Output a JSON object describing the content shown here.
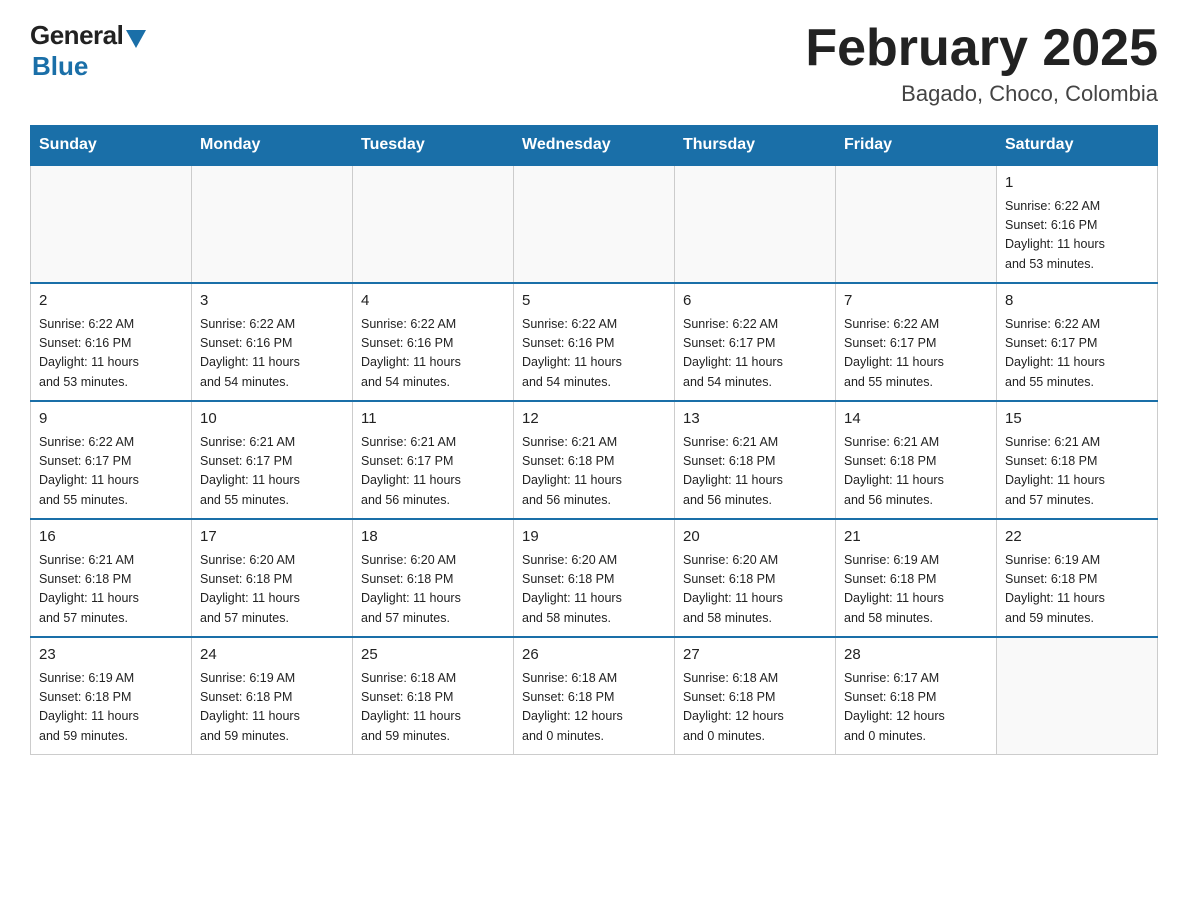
{
  "header": {
    "logo_general": "General",
    "logo_blue": "Blue",
    "title": "February 2025",
    "location": "Bagado, Choco, Colombia"
  },
  "days_of_week": [
    "Sunday",
    "Monday",
    "Tuesday",
    "Wednesday",
    "Thursday",
    "Friday",
    "Saturday"
  ],
  "weeks": [
    [
      {
        "day": "",
        "info": ""
      },
      {
        "day": "",
        "info": ""
      },
      {
        "day": "",
        "info": ""
      },
      {
        "day": "",
        "info": ""
      },
      {
        "day": "",
        "info": ""
      },
      {
        "day": "",
        "info": ""
      },
      {
        "day": "1",
        "info": "Sunrise: 6:22 AM\nSunset: 6:16 PM\nDaylight: 11 hours\nand 53 minutes."
      }
    ],
    [
      {
        "day": "2",
        "info": "Sunrise: 6:22 AM\nSunset: 6:16 PM\nDaylight: 11 hours\nand 53 minutes."
      },
      {
        "day": "3",
        "info": "Sunrise: 6:22 AM\nSunset: 6:16 PM\nDaylight: 11 hours\nand 54 minutes."
      },
      {
        "day": "4",
        "info": "Sunrise: 6:22 AM\nSunset: 6:16 PM\nDaylight: 11 hours\nand 54 minutes."
      },
      {
        "day": "5",
        "info": "Sunrise: 6:22 AM\nSunset: 6:16 PM\nDaylight: 11 hours\nand 54 minutes."
      },
      {
        "day": "6",
        "info": "Sunrise: 6:22 AM\nSunset: 6:17 PM\nDaylight: 11 hours\nand 54 minutes."
      },
      {
        "day": "7",
        "info": "Sunrise: 6:22 AM\nSunset: 6:17 PM\nDaylight: 11 hours\nand 55 minutes."
      },
      {
        "day": "8",
        "info": "Sunrise: 6:22 AM\nSunset: 6:17 PM\nDaylight: 11 hours\nand 55 minutes."
      }
    ],
    [
      {
        "day": "9",
        "info": "Sunrise: 6:22 AM\nSunset: 6:17 PM\nDaylight: 11 hours\nand 55 minutes."
      },
      {
        "day": "10",
        "info": "Sunrise: 6:21 AM\nSunset: 6:17 PM\nDaylight: 11 hours\nand 55 minutes."
      },
      {
        "day": "11",
        "info": "Sunrise: 6:21 AM\nSunset: 6:17 PM\nDaylight: 11 hours\nand 56 minutes."
      },
      {
        "day": "12",
        "info": "Sunrise: 6:21 AM\nSunset: 6:18 PM\nDaylight: 11 hours\nand 56 minutes."
      },
      {
        "day": "13",
        "info": "Sunrise: 6:21 AM\nSunset: 6:18 PM\nDaylight: 11 hours\nand 56 minutes."
      },
      {
        "day": "14",
        "info": "Sunrise: 6:21 AM\nSunset: 6:18 PM\nDaylight: 11 hours\nand 56 minutes."
      },
      {
        "day": "15",
        "info": "Sunrise: 6:21 AM\nSunset: 6:18 PM\nDaylight: 11 hours\nand 57 minutes."
      }
    ],
    [
      {
        "day": "16",
        "info": "Sunrise: 6:21 AM\nSunset: 6:18 PM\nDaylight: 11 hours\nand 57 minutes."
      },
      {
        "day": "17",
        "info": "Sunrise: 6:20 AM\nSunset: 6:18 PM\nDaylight: 11 hours\nand 57 minutes."
      },
      {
        "day": "18",
        "info": "Sunrise: 6:20 AM\nSunset: 6:18 PM\nDaylight: 11 hours\nand 57 minutes."
      },
      {
        "day": "19",
        "info": "Sunrise: 6:20 AM\nSunset: 6:18 PM\nDaylight: 11 hours\nand 58 minutes."
      },
      {
        "day": "20",
        "info": "Sunrise: 6:20 AM\nSunset: 6:18 PM\nDaylight: 11 hours\nand 58 minutes."
      },
      {
        "day": "21",
        "info": "Sunrise: 6:19 AM\nSunset: 6:18 PM\nDaylight: 11 hours\nand 58 minutes."
      },
      {
        "day": "22",
        "info": "Sunrise: 6:19 AM\nSunset: 6:18 PM\nDaylight: 11 hours\nand 59 minutes."
      }
    ],
    [
      {
        "day": "23",
        "info": "Sunrise: 6:19 AM\nSunset: 6:18 PM\nDaylight: 11 hours\nand 59 minutes."
      },
      {
        "day": "24",
        "info": "Sunrise: 6:19 AM\nSunset: 6:18 PM\nDaylight: 11 hours\nand 59 minutes."
      },
      {
        "day": "25",
        "info": "Sunrise: 6:18 AM\nSunset: 6:18 PM\nDaylight: 11 hours\nand 59 minutes."
      },
      {
        "day": "26",
        "info": "Sunrise: 6:18 AM\nSunset: 6:18 PM\nDaylight: 12 hours\nand 0 minutes."
      },
      {
        "day": "27",
        "info": "Sunrise: 6:18 AM\nSunset: 6:18 PM\nDaylight: 12 hours\nand 0 minutes."
      },
      {
        "day": "28",
        "info": "Sunrise: 6:17 AM\nSunset: 6:18 PM\nDaylight: 12 hours\nand 0 minutes."
      },
      {
        "day": "",
        "info": ""
      }
    ]
  ]
}
